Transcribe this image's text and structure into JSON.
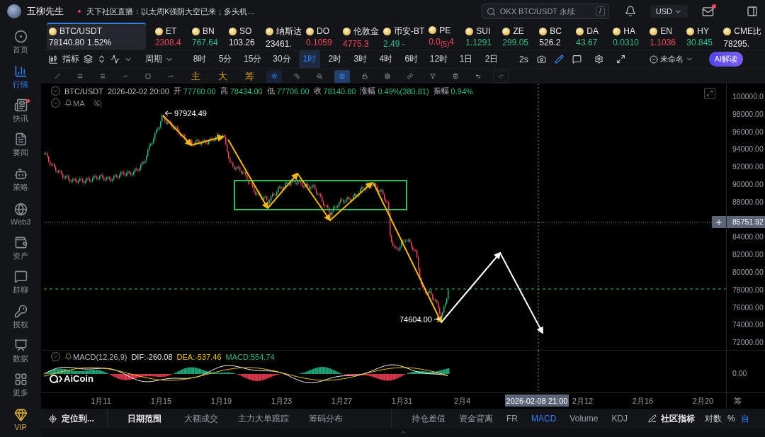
{
  "top_bar": {
    "user_name": "五柳先生",
    "live_notice": "天下社区直播：以太周K强阴大空已来；多头机…",
    "search": {
      "placeholder": "OKX BTC/USDT 永续",
      "shortcut": "/"
    },
    "currency": "USD",
    "mail_unread": true
  },
  "sidebar": {
    "items": [
      {
        "label": "首页",
        "selected": false,
        "badge": false
      },
      {
        "label": "行情",
        "selected": true,
        "badge": false
      },
      {
        "label": "快讯",
        "selected": false,
        "badge": true
      },
      {
        "label": "要闻",
        "selected": false,
        "badge": false
      },
      {
        "label": "策略",
        "selected": false,
        "badge": false
      },
      {
        "label": "Web3",
        "selected": false,
        "badge": false
      },
      {
        "label": "资产",
        "selected": false,
        "badge": false
      },
      {
        "label": "群聊",
        "selected": false,
        "badge": false
      },
      {
        "label": "授权",
        "selected": false,
        "badge": false
      },
      {
        "label": "数据",
        "selected": false,
        "badge": false
      },
      {
        "label": "更多",
        "selected": false,
        "badge": false
      },
      {
        "label": "VIP",
        "selected": false,
        "badge": false
      }
    ]
  },
  "tickers": [
    {
      "name": "BTC/USDT",
      "price": "78140.80",
      "change": "1.52%",
      "color": "#e6e6e6",
      "selected": true
    },
    {
      "name": "ET",
      "price": "2308.4",
      "color": "#f6465d",
      "selected": false
    },
    {
      "name": "BN",
      "price": "767.64",
      "color": "#2ebd85",
      "selected": false
    },
    {
      "name": "SO",
      "price": "103.26",
      "color": "#e6e6e6",
      "selected": false
    },
    {
      "name": "纳斯达",
      "price": "23461.",
      "color": "#e6e6e6",
      "selected": false
    },
    {
      "name": "DO",
      "price": "0.1059",
      "color": "#f6465d",
      "selected": false
    },
    {
      "name": "伦敦金",
      "price": "4775.3",
      "color": "#f6465d",
      "selected": false
    },
    {
      "name": "币安-BT",
      "price": "2.49 -",
      "color": "#2ebd85",
      "selected": false
    },
    {
      "name": "PE",
      "price": "0.0$_{(5)}$4",
      "color": "#f6465d",
      "selected": false
    },
    {
      "name": "SUI",
      "price": "1.1291",
      "color": "#2ebd85",
      "selected": false
    },
    {
      "name": "ZE",
      "price": "299.05",
      "color": "#2ebd85",
      "selected": false
    },
    {
      "name": "BC",
      "price": "526.2",
      "color": "#e6e6e6",
      "selected": false
    },
    {
      "name": "DA",
      "price": "43.67",
      "color": "#2ebd85",
      "selected": false
    },
    {
      "name": "HA",
      "price": "0.0310",
      "color": "#2ebd85",
      "selected": false
    },
    {
      "name": "EN",
      "price": "1.1036",
      "color": "#f6465d",
      "selected": false
    },
    {
      "name": "HY",
      "price": "30.845",
      "color": "#2ebd85",
      "selected": false
    },
    {
      "name": "CME比",
      "price": "78295.",
      "color": "#e6e6e6",
      "selected": false
    }
  ],
  "toolbar": {
    "indicator_label": "指标",
    "period_label": "周期",
    "intervals": [
      {
        "label": "8时",
        "selected": false
      },
      {
        "label": "5分",
        "selected": false
      },
      {
        "label": "15分",
        "selected": false
      },
      {
        "label": "30分",
        "selected": false
      },
      {
        "label": "1时",
        "selected": true
      },
      {
        "label": "2时",
        "selected": false
      },
      {
        "label": "3时",
        "selected": false
      },
      {
        "label": "4时",
        "selected": false
      },
      {
        "label": "6时",
        "selected": false
      },
      {
        "label": "12时",
        "selected": false
      },
      {
        "label": "1日",
        "selected": false
      },
      {
        "label": "2日",
        "selected": false
      }
    ],
    "refresh": "2s",
    "layout_name": "未命名",
    "ai_button": "AI解读"
  },
  "drawing_tools": [
    {
      "kind": "icon",
      "selected": false,
      "disabled": false
    },
    {
      "kind": "icon",
      "selected": false,
      "disabled": false
    },
    {
      "kind": "icon",
      "selected": false,
      "disabled": false
    },
    {
      "kind": "icon",
      "selected": false,
      "disabled": false
    },
    {
      "kind": "icon",
      "selected": false,
      "disabled": false
    },
    {
      "kind": "icon",
      "selected": false,
      "disabled": false
    },
    {
      "kind": "text",
      "label": "主",
      "selected": false,
      "disabled": false
    },
    {
      "kind": "text",
      "label": "大",
      "selected": false,
      "disabled": false
    },
    {
      "kind": "text",
      "label": "筹",
      "selected": false,
      "disabled": false
    },
    {
      "kind": "icon",
      "selected": true,
      "disabled": false
    },
    {
      "kind": "icon",
      "selected": false,
      "disabled": false
    },
    {
      "kind": "icon",
      "selected": false,
      "disabled": false
    },
    {
      "kind": "icon",
      "selected": true,
      "disabled": false
    },
    {
      "kind": "icon",
      "selected": false,
      "disabled": false
    },
    {
      "kind": "icon",
      "selected": false,
      "disabled": false
    },
    {
      "kind": "icon",
      "selected": false,
      "disabled": false
    },
    {
      "kind": "icon",
      "selected": false,
      "disabled": false
    },
    {
      "kind": "icon",
      "selected": false,
      "disabled": false
    },
    {
      "kind": "icon",
      "selected": false,
      "disabled": false
    },
    {
      "kind": "icon",
      "selected": false,
      "disabled": true
    }
  ],
  "chart": {
    "symbol": "BTC/USDT",
    "datetime": "2026-02-02 20:00",
    "quote": [
      {
        "label": "开",
        "value": "77760.00"
      },
      {
        "label": "高",
        "value": "78434.00"
      },
      {
        "label": "低",
        "value": "77706.00"
      },
      {
        "label": "收",
        "value": "78140.80"
      },
      {
        "label": "涨幅",
        "value": "0.49%(380.81)"
      },
      {
        "label": "振幅",
        "value": "0.94%"
      }
    ],
    "ma_label": "MA",
    "high_marker": "97924.49",
    "low_marker": "74604.00",
    "price_axis": [
      "100000.0",
      "98000.00",
      "96000.00",
      "94000.00",
      "92000.00",
      "90000.00",
      "88000.00",
      "84000.00",
      "82000.00",
      "80000.00",
      "78000.00",
      "76000.00",
      "74000.00",
      "72000.00"
    ],
    "crosshair_price": "85751.92"
  },
  "macd": {
    "title": "MACD(12,26,9)",
    "dif": "DIF:-260.08",
    "dea": "DEA:-537.46",
    "value": "MACD:554.74",
    "axis_label": "0.00",
    "logo_text": "AiCoin"
  },
  "time_axis": {
    "labels": [
      "1月11",
      "1月15",
      "1月19",
      "1月23",
      "1月27",
      "1月31",
      "2月4",
      "2月12",
      "2月16",
      "2月20"
    ],
    "crosshair_time": "2026-02-08 21:00",
    "corner": "筹"
  },
  "bottom_bar": {
    "locate": "定位到...",
    "date_range": "日期范围",
    "tools": [
      {
        "label": "大额成交",
        "selected": false
      },
      {
        "label": "主力大单跟踪",
        "selected": false
      },
      {
        "label": "筹码分布",
        "selected": false
      }
    ],
    "indicators": [
      {
        "label": "持仓差值",
        "selected": false
      },
      {
        "label": "资金背离",
        "selected": false
      },
      {
        "label": "FR",
        "selected": false
      },
      {
        "label": "MACD",
        "selected": true
      },
      {
        "label": "Volume",
        "selected": false
      },
      {
        "label": "KDJ",
        "selected": false
      }
    ],
    "community": "社区指标",
    "log": "对数",
    "percent": "%",
    "auto": "自"
  }
}
